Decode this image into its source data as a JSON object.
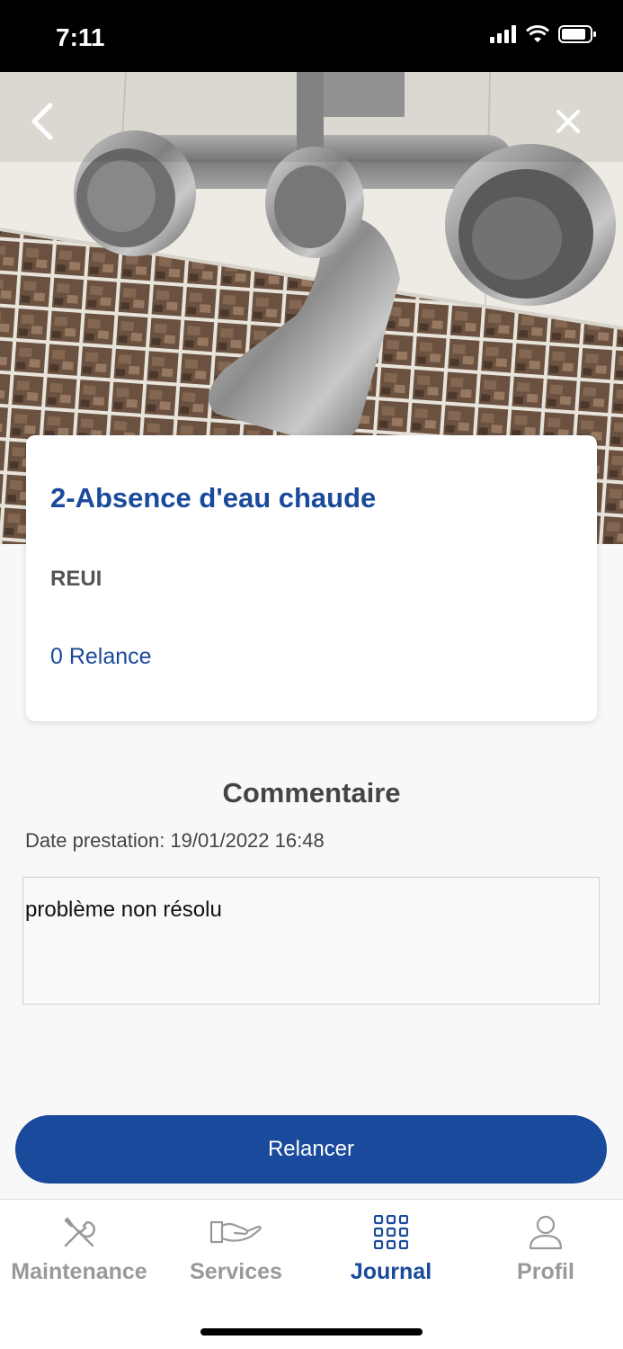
{
  "status_bar": {
    "time": "7:11"
  },
  "issue": {
    "title": "2-Absence d'eau chaude",
    "code": "REUI",
    "relance_text": "0 Relance"
  },
  "comment": {
    "heading": "Commentaire",
    "date_text": "Date prestation: 19/01/2022 16:48",
    "value": "problème non résolu"
  },
  "action_button": {
    "label": "Relancer"
  },
  "tab_bar": {
    "active": "Journal",
    "tabs": [
      {
        "label": "Maintenance",
        "icon": "wrench-screwdriver-icon"
      },
      {
        "label": "Services",
        "icon": "hand-icon"
      },
      {
        "label": "Journal",
        "icon": "grid-icon"
      },
      {
        "label": "Profil",
        "icon": "person-icon"
      }
    ]
  },
  "colors": {
    "accent": "#1a4a9b",
    "inactive": "#999999"
  }
}
